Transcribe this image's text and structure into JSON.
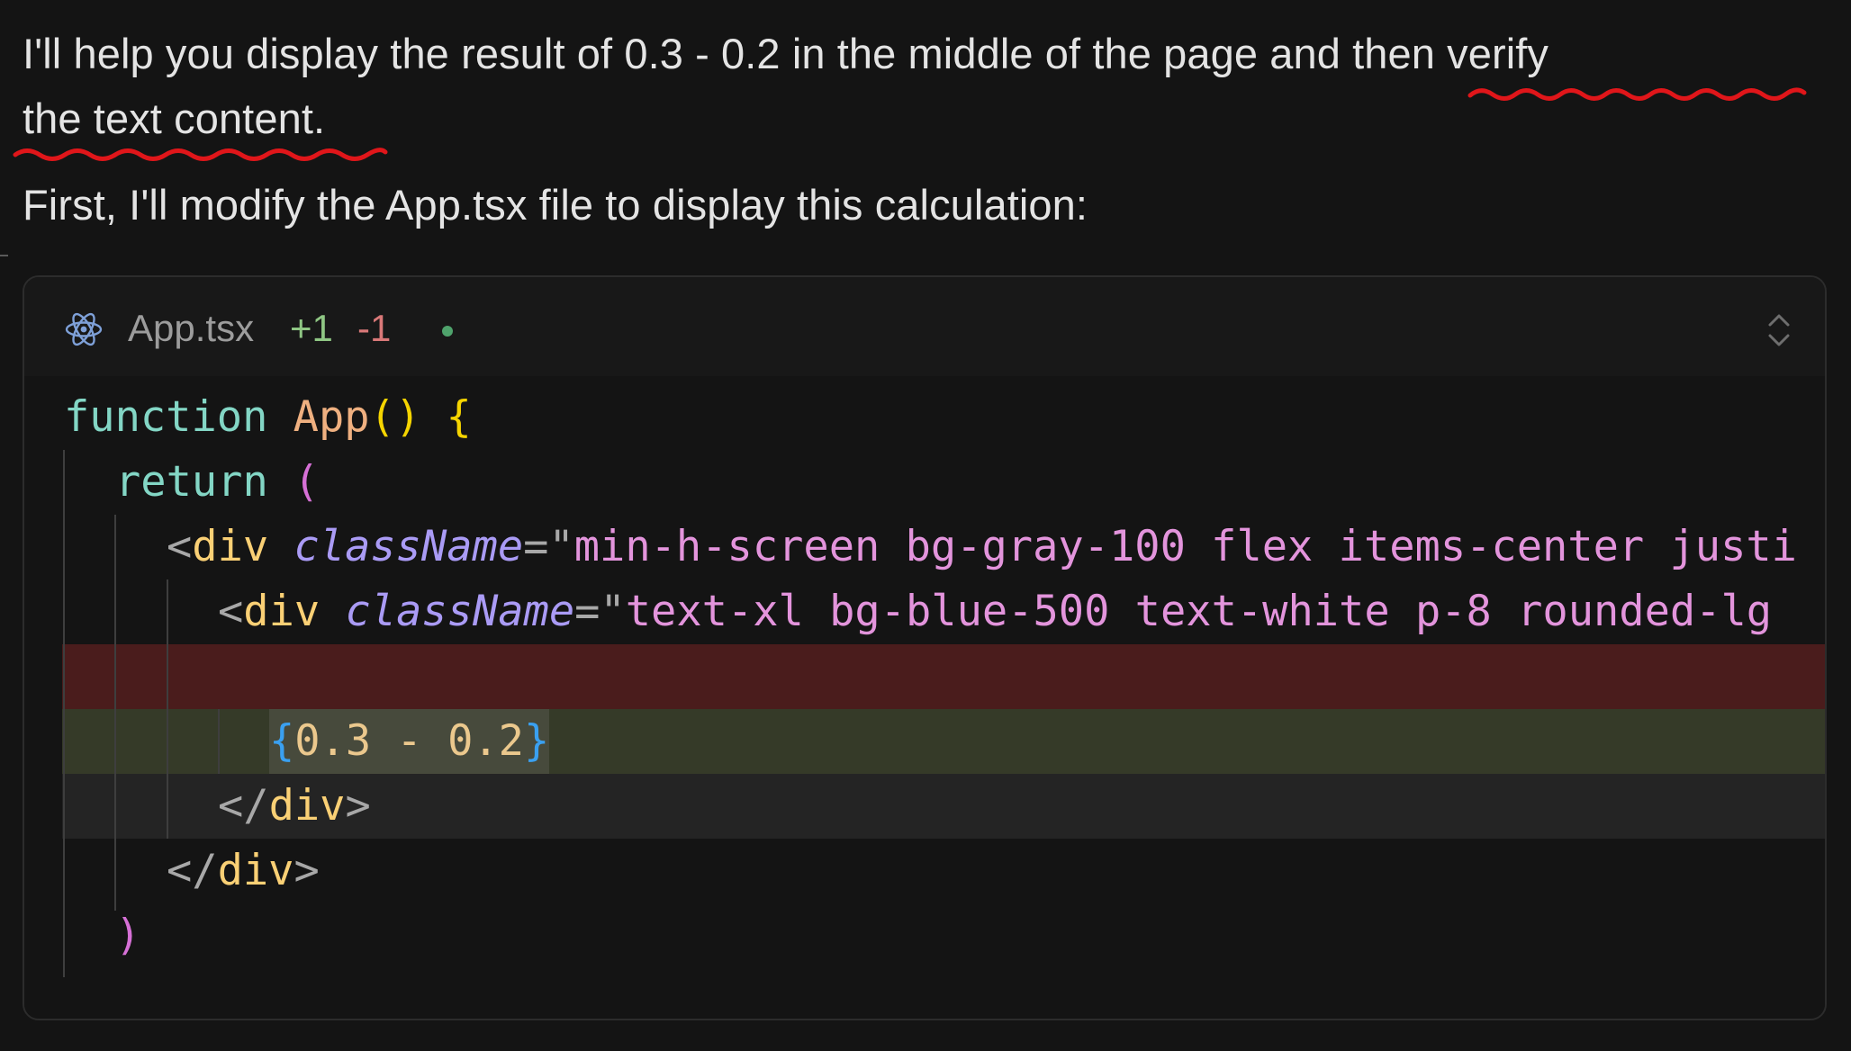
{
  "message": {
    "line1_a": "I'll help you display the result of 0.3 - 0.2 in the middle of the page ",
    "line1_b": "and then verify",
    "line2": "the text content.",
    "line3": "First, I'll modify the App.tsx file to display this calculation:"
  },
  "file_card": {
    "file_name": "App.tsx",
    "additions": "+1",
    "deletions": "-1",
    "file_icon": "react-icon",
    "expand_icon": "chevron-up-down-icon"
  },
  "code": {
    "l1_kw": "function",
    "l1_fn": "App",
    "l1_parens": "()",
    "l1_brace": "{",
    "l2_kw": "return",
    "l2_paren": "(",
    "l3_open": "<",
    "l3_tag": "div",
    "l3_attr": "className",
    "l3_eq": "=\"",
    "l3_str": "min-h-screen bg-gray-100 flex items-center justi",
    "l4_open": "<",
    "l4_tag": "div",
    "l4_attr": "className",
    "l4_eq": "=\"",
    "l4_str": "text-xl bg-blue-500 text-white p-8 rounded-lg",
    "l6_ob": "{",
    "l6_expr": "0.3 - 0.2",
    "l6_cb": "}",
    "l7_open": "</",
    "l7_tag": "div",
    "l7_close": ">",
    "l8_open": "</",
    "l8_tag": "div",
    "l8_close": ">",
    "l9_paren": ")"
  },
  "colors": {
    "background": "#141414",
    "deleted_line": "#4a1c1c",
    "added_line": "#353a28",
    "squiggle": "#e0161a"
  }
}
